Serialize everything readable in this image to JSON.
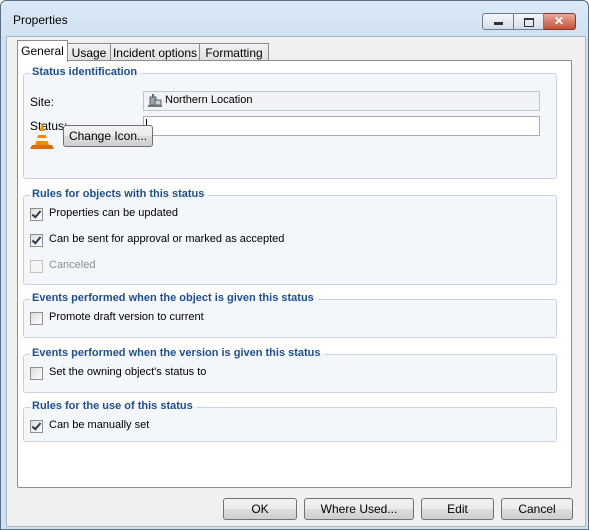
{
  "window": {
    "title": "Properties",
    "close_glyph": "✕"
  },
  "tabs": [
    {
      "label": "General",
      "active": true
    },
    {
      "label": "Usage",
      "active": false
    },
    {
      "label": "Incident options",
      "active": false
    },
    {
      "label": "Formatting",
      "active": false
    }
  ],
  "status_identification": {
    "title": "Status identification",
    "site_label": "Site:",
    "site_value": "Northern Location",
    "site_icon": "site-building-icon",
    "status_label": "Status:",
    "status_value": "",
    "status_icon": "traffic-cone-icon",
    "change_icon_label": "Change Icon..."
  },
  "rules_objects": {
    "title": "Rules for objects with this status",
    "items": [
      {
        "label": "Properties can be updated",
        "checked": true,
        "enabled": true
      },
      {
        "label": "Can be sent for approval or marked as accepted",
        "checked": true,
        "enabled": true
      },
      {
        "label": "Canceled",
        "checked": false,
        "enabled": false
      }
    ]
  },
  "events_object": {
    "title": "Events performed when the object is given this status",
    "items": [
      {
        "label": "Promote draft version to current",
        "checked": false,
        "enabled": true
      }
    ]
  },
  "events_version": {
    "title": "Events performed when the version is given this status",
    "items": [
      {
        "label": "Set the owning object's status to",
        "checked": false,
        "enabled": true
      }
    ]
  },
  "rules_use": {
    "title": "Rules for the use of this status",
    "items": [
      {
        "label": "Can be manually set",
        "checked": true,
        "enabled": true
      }
    ]
  },
  "buttons": {
    "ok": "OK",
    "where_used": "Where Used...",
    "edit": "Edit",
    "cancel": "Cancel"
  },
  "colors": {
    "group_title": "#1f4e8c",
    "window_frame": "#cfe0f1",
    "cone_orange": "#f08a00"
  }
}
